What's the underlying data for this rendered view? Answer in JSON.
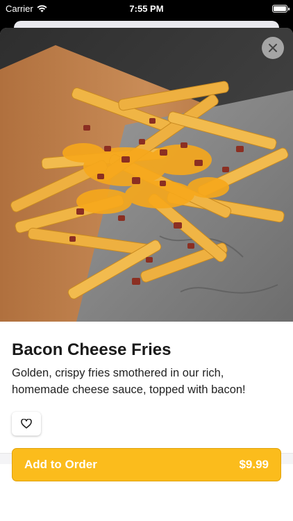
{
  "status_bar": {
    "carrier": "Carrier",
    "time": "7:55 PM"
  },
  "item": {
    "title": "Bacon Cheese Fries",
    "description": "Golden, crispy fries smothered in our rich, homemade cheese sauce, topped with bacon!"
  },
  "order_button": {
    "label": "Add to Order",
    "price": "$9.99"
  },
  "colors": {
    "accent": "#fbbc1c",
    "accent_border": "#e1a20a"
  },
  "icons": {
    "close": "close-icon",
    "favorite": "heart-icon",
    "wifi": "wifi-icon",
    "battery": "battery-icon"
  }
}
